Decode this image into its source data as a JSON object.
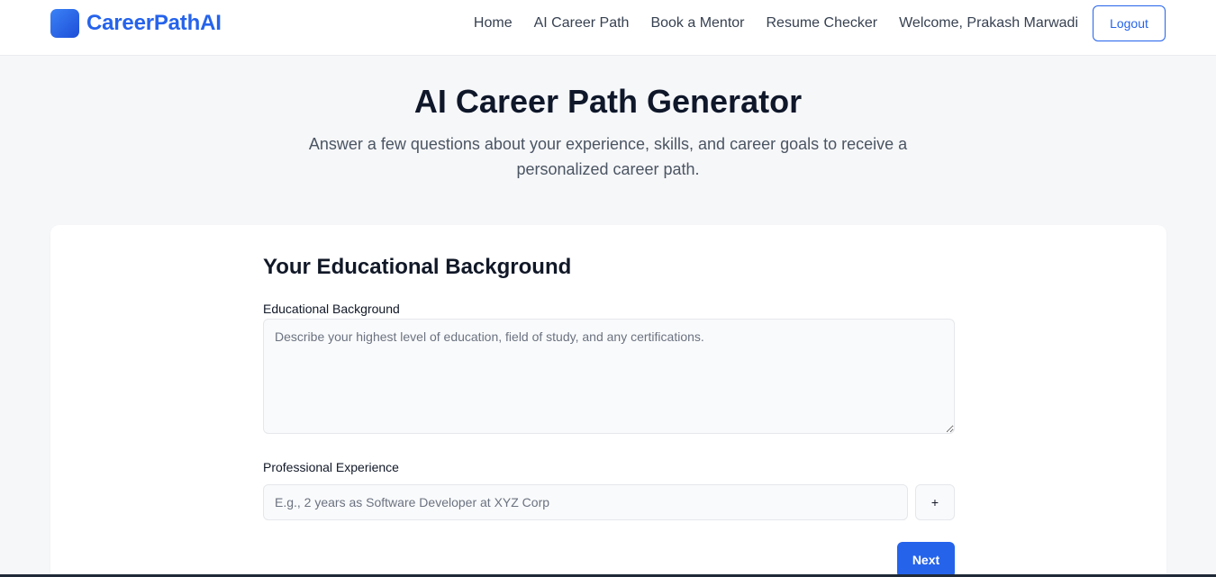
{
  "nav": {
    "brand": "CareerPathAI",
    "links": [
      "Home",
      "AI Career Path",
      "Book a Mentor",
      "Resume Checker"
    ],
    "welcome": "Welcome, Prakash Marwadi",
    "logout_label": "Logout"
  },
  "hero": {
    "title": "AI Career Path Generator",
    "subtitle": "Answer a few questions about your experience, skills, and career goals to receive a personalized career path."
  },
  "form": {
    "section_title": "Your Educational Background",
    "education_label": "Educational Background",
    "education_placeholder": "Describe your highest level of education, field of study, and any certifications.",
    "education_value": "",
    "experience_label": "Professional Experience",
    "experience_placeholder": "E.g., 2 years as Software Developer at XYZ Corp",
    "experience_value": "",
    "add_label": "+",
    "next_label": "Next"
  },
  "colors": {
    "primary": "#2563eb",
    "background": "#f6f7f9",
    "card": "#ffffff"
  },
  "icons": {
    "brand_logo": "gradient-square-logo",
    "add": "plus-icon"
  }
}
